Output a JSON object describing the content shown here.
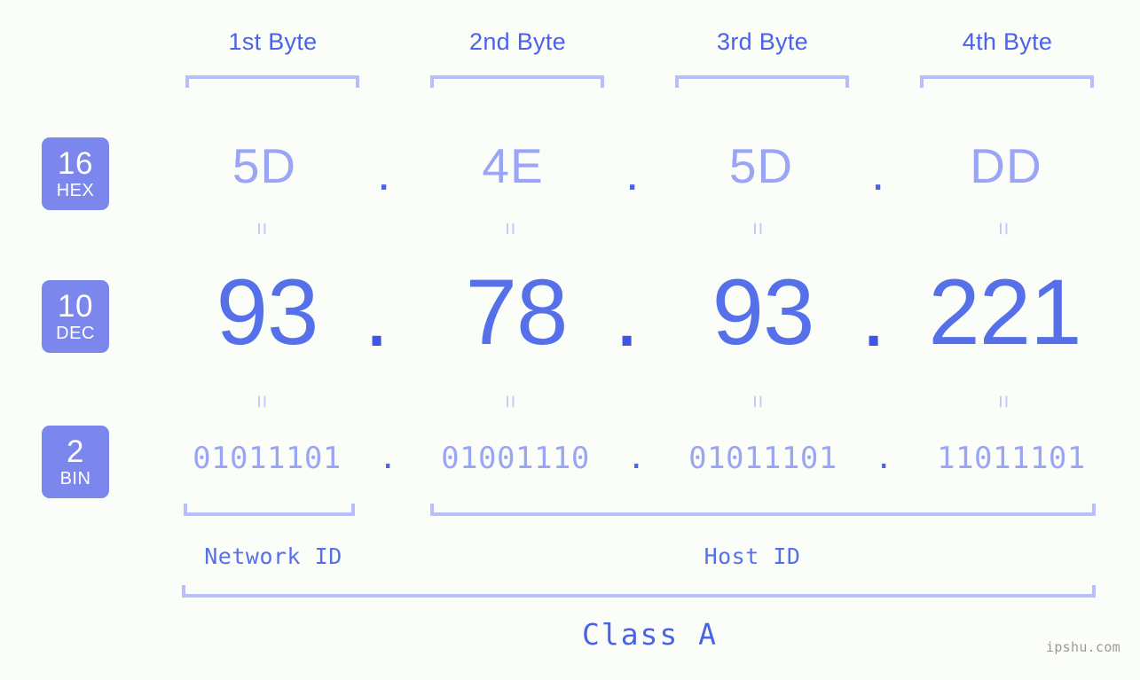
{
  "page": {
    "background_color": "#fbfdf8",
    "accent_color": "#5670ea",
    "badge_color": "#7b87ec",
    "light_accent_color": "#9aa6f5",
    "bracket_color": "#b6bffb"
  },
  "byte_headers": [
    {
      "label": "1st Byte"
    },
    {
      "label": "2nd Byte"
    },
    {
      "label": "3rd Byte"
    },
    {
      "label": "4th Byte"
    }
  ],
  "rows": [
    {
      "badge": {
        "base": "16",
        "name": "HEX"
      },
      "values": [
        "5D",
        "4E",
        "5D",
        "DD"
      ],
      "separator": "."
    },
    {
      "badge": {
        "base": "10",
        "name": "DEC"
      },
      "values": [
        "93",
        "78",
        "93",
        "221"
      ],
      "separator": "."
    },
    {
      "badge": {
        "base": "2",
        "name": "BIN"
      },
      "values": [
        "01011101",
        "01001110",
        "01011101",
        "11011101"
      ],
      "separator": "."
    }
  ],
  "equals_mark": "=",
  "segments": {
    "network_id": "Network ID",
    "host_id": "Host ID",
    "class": "Class A"
  },
  "watermark": "ipshu.com"
}
